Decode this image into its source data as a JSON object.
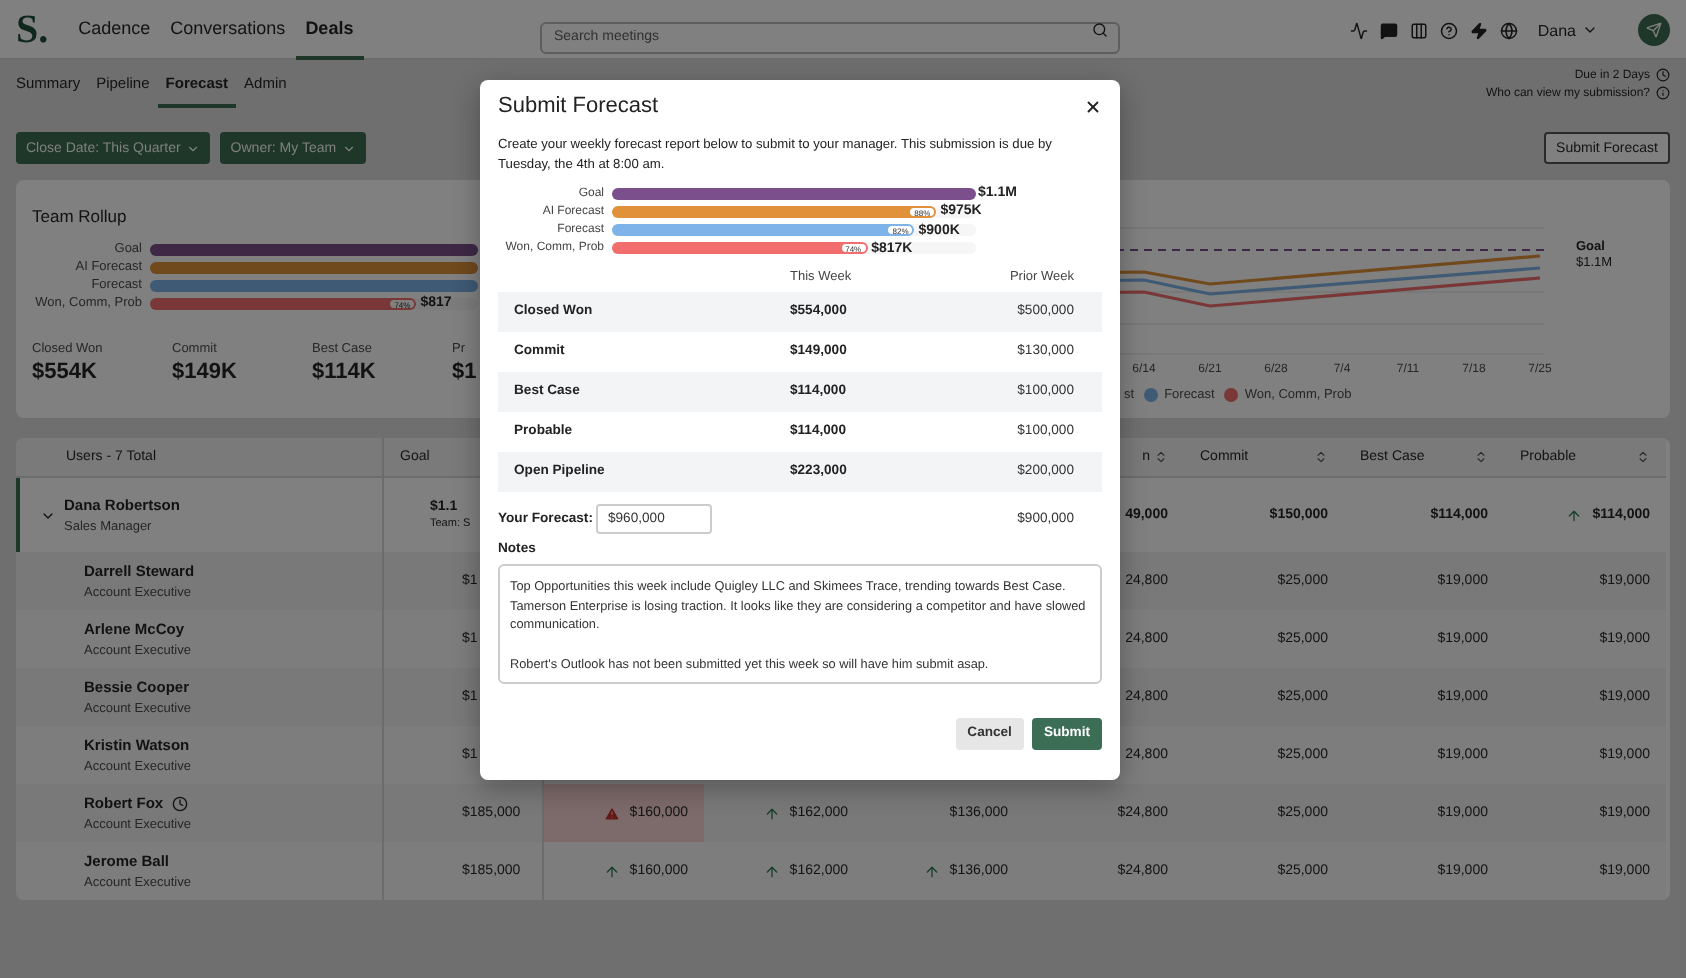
{
  "header": {
    "logo": "S.",
    "nav": [
      {
        "label": "Cadence",
        "selected": false
      },
      {
        "label": "Conversations",
        "selected": false
      },
      {
        "label": "Deals",
        "selected": true
      }
    ],
    "search": {
      "placeholder": "Search meetings"
    },
    "user": "Dana"
  },
  "subnav": {
    "tabs": [
      {
        "label": "Summary",
        "selected": false
      },
      {
        "label": "Pipeline",
        "selected": false
      },
      {
        "label": "Forecast",
        "selected": true
      },
      {
        "label": "Admin",
        "selected": false
      }
    ],
    "due": "Due in 2 Days",
    "visibility_link": "Who can view my submission?"
  },
  "filters": [
    {
      "label": "Close Date: This Quarter"
    },
    {
      "label": "Owner: My Team"
    }
  ],
  "submit_button": "Submit Forecast",
  "rollup": {
    "title": "Team Rollup",
    "bars": [
      {
        "label": "Goal",
        "level": 1,
        "color": "#3e2846"
      },
      {
        "label": "AI Forecast",
        "level": 1,
        "color": "#70491d"
      },
      {
        "label": "Forecast",
        "level": 1,
        "color": "#3f5a74"
      },
      {
        "label": "Won, Comm, Prob",
        "level": 0.8,
        "color": "#793737",
        "badge": "74%",
        "value": "$817"
      }
    ],
    "kpis": [
      {
        "label": "Closed Won",
        "value": "$554K"
      },
      {
        "label": "Commit",
        "value": "$149K"
      },
      {
        "label": "Best Case",
        "value": "$114K"
      },
      {
        "label": "Pr",
        "value": "$1"
      }
    ],
    "chart": {
      "goal_label": "Goal",
      "goal_value": "$1.1M",
      "x_labels": [
        "6/14",
        "6/21",
        "6/28",
        "7/4",
        "7/11",
        "7/18",
        "7/25"
      ],
      "legend": [
        {
          "label": "st"
        },
        {
          "label": "Forecast",
          "color": "#3f5a74"
        },
        {
          "label": "Won, Comm, Prob",
          "color": "#793737"
        }
      ]
    }
  },
  "table": {
    "user_column": "Users - 7 Total",
    "columns": [
      {
        "label": "Goal"
      },
      null,
      null,
      null,
      {
        "label": "n",
        "sortable": true
      },
      {
        "label": "Commit",
        "sortable": true
      },
      {
        "label": "Best Case",
        "sortable": true
      },
      {
        "label": "Probable",
        "sortable": true
      }
    ],
    "rows": [
      {
        "name": "Dana Robertson",
        "role": "Sales Manager",
        "kind": "manager",
        "expanded": true,
        "selected": true,
        "pending": false,
        "cells": [
          {
            "text": "$1.1",
            "note": "Team: S"
          },
          null,
          null,
          null,
          "49,000",
          "$150,000",
          "$114,000",
          {
            "text": "$114,000",
            "rising": true
          }
        ]
      },
      {
        "name": "Darrell Steward",
        "role": "Account Executive",
        "kind": "member",
        "selected": false,
        "pending": false,
        "cells": [
          "$1",
          null,
          null,
          null,
          "24,800",
          "$25,000",
          "$19,000",
          "$19,000"
        ]
      },
      {
        "name": "Arlene McCoy",
        "role": "Account Executive",
        "kind": "member",
        "selected": false,
        "pending": false,
        "cells": [
          "$1",
          null,
          null,
          null,
          "24,800",
          "$25,000",
          "$19,000",
          "$19,000"
        ]
      },
      {
        "name": "Bessie Cooper",
        "role": "Account Executive",
        "kind": "member",
        "selected": false,
        "pending": false,
        "cells": [
          "$1",
          null,
          null,
          null,
          "24,800",
          "$25,000",
          "$19,000",
          "$19,000"
        ]
      },
      {
        "name": "Kristin Watson",
        "role": "Account Executive",
        "kind": "member",
        "selected": false,
        "pending": false,
        "cells": [
          "$1",
          null,
          null,
          null,
          "24,800",
          "$25,000",
          "$19,000",
          "$19,000"
        ]
      },
      {
        "name": "Robert Fox",
        "role": "Account Executive",
        "kind": "member",
        "selected": false,
        "pending": true,
        "cells": [
          "$185,000",
          {
            "text": "$160,000",
            "warning": true
          },
          {
            "text": "$162,000",
            "rising": true
          },
          "$136,000",
          "$24,800",
          "$25,000",
          "$19,000",
          "$19,000"
        ]
      },
      {
        "name": "Jerome Ball",
        "role": "Account Executive",
        "kind": "member",
        "selected": false,
        "pending": false,
        "cells": [
          "$185,000",
          {
            "text": "$160,000",
            "rising": true
          },
          {
            "text": "$162,000",
            "rising": true
          },
          {
            "text": "$136,000",
            "rising": true
          },
          "$24,800",
          "$25,000",
          "$19,000",
          "$19,000"
        ]
      }
    ]
  },
  "modal": {
    "title": "Submit Forecast",
    "description": "Create your weekly forecast report below to submit to your manager. This submission is due by Tuesday, the 4th at 8:00 am.",
    "bars": [
      {
        "label": "Goal",
        "level": 1,
        "color": "#7b4f8c",
        "value": "$1.1M"
      },
      {
        "label": "AI Forecast",
        "level": 0.88,
        "color": "#e0913a",
        "badge": "88%",
        "value": "$975K"
      },
      {
        "label": "Forecast",
        "level": 0.82,
        "color": "#7db3e8",
        "badge": "82%",
        "value": "$900K"
      },
      {
        "label": "Won, Comm, Prob",
        "level": 0.69,
        "color": "#f26d6d",
        "badge": "74%",
        "value": "$817K"
      }
    ],
    "columns": [
      "This Week",
      "Prior Week"
    ],
    "rows": [
      {
        "label": "Closed Won",
        "this_week": "$554,000",
        "prior_week": "$500,000"
      },
      {
        "label": "Commit",
        "this_week": "$149,000",
        "prior_week": "$130,000"
      },
      {
        "label": "Best Case",
        "this_week": "$114,000",
        "prior_week": "$100,000"
      },
      {
        "label": "Probable",
        "this_week": "$114,000",
        "prior_week": "$100,000"
      },
      {
        "label": "Open Pipeline",
        "this_week": "$223,000",
        "prior_week": "$200,000"
      }
    ],
    "forecast": {
      "label": "Your Forecast:",
      "value": "$960,000",
      "prior_week": "$900,000"
    },
    "notes": {
      "label": "Notes",
      "value": "Top Opportunities this week include Quigley LLC and Skimees Trace, trending towards Best Case. Tamerson Enterprise is losing traction. It looks like they are considering a competitor and have slowed communication.\n\nRobert's Outlook has not been submitted yet this week so will have him submit asap."
    },
    "buttons": [
      {
        "label": "Cancel",
        "kind": "secondary"
      },
      {
        "label": "Submit",
        "kind": "primary"
      }
    ]
  }
}
